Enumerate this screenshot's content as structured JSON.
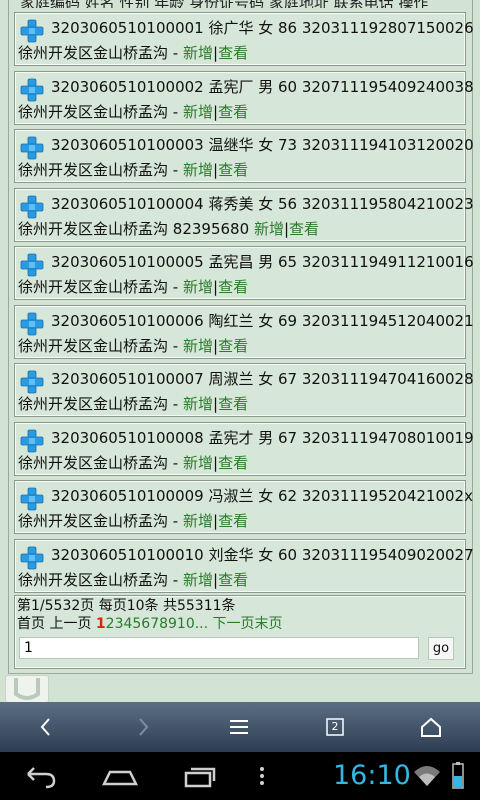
{
  "header": {
    "text": "家庭编码 姓名 性别 年龄 身份证号码 家庭地址 联系电话 操作"
  },
  "rows": [
    {
      "line1": "3203060510100001 徐广华 女 86 320311192807150026",
      "address": "徐州开发区金山桥孟沟",
      "phone": "-",
      "add": "新增",
      "sep": "|",
      "view": "查看"
    },
    {
      "line1": "3203060510100002 孟宪厂 男 60 320711195409240038",
      "address": "徐州开发区金山桥孟沟",
      "phone": "-",
      "add": "新增",
      "sep": "|",
      "view": "查看"
    },
    {
      "line1": "3203060510100003 温继华 女 73 320311194103120020",
      "address": "徐州开发区金山桥孟沟",
      "phone": "-",
      "add": "新增",
      "sep": "|",
      "view": "查看"
    },
    {
      "line1": "3203060510100004 蒋秀美 女 56 320311195804210023",
      "address": "徐州开发区金山桥孟沟",
      "phone": "82395680",
      "add": "新增",
      "sep": "|",
      "view": "查看"
    },
    {
      "line1": "3203060510100005 孟宪昌 男 65 320311194911210016",
      "address": "徐州开发区金山桥孟沟",
      "phone": "-",
      "add": "新增",
      "sep": "|",
      "view": "查看"
    },
    {
      "line1": "3203060510100006 陶红兰 女 69 320311194512040021",
      "address": "徐州开发区金山桥孟沟",
      "phone": "-",
      "add": "新增",
      "sep": "|",
      "view": "查看"
    },
    {
      "line1": "3203060510100007 周淑兰 女 67 320311194704160028",
      "address": "徐州开发区金山桥孟沟",
      "phone": "-",
      "add": "新增",
      "sep": "|",
      "view": "查看"
    },
    {
      "line1": "3203060510100008 孟宪才 男 67 320311194708010019",
      "address": "徐州开发区金山桥孟沟",
      "phone": "-",
      "add": "新增",
      "sep": "|",
      "view": "查看"
    },
    {
      "line1": "3203060510100009 冯淑兰 女 62 32031119520421002x",
      "address": "徐州开发区金山桥孟沟",
      "phone": "-",
      "add": "新增",
      "sep": "|",
      "view": "查看"
    },
    {
      "line1": "3203060510100010 刘金华 女 60 320311195409020027",
      "address": "徐州开发区金山桥孟沟",
      "phone": "-",
      "add": "新增",
      "sep": "|",
      "view": "查看"
    }
  ],
  "pager": {
    "info": "第1/5532页 每页10条 共55311条",
    "first": "首页",
    "prev": "上一页",
    "current": "1",
    "pages": "2345678910...",
    "next": "下一页",
    "last": "末页",
    "input_value": "1",
    "go": "go"
  },
  "navbar": {
    "tabs_count": "2"
  },
  "status": {
    "time": "16:10"
  }
}
